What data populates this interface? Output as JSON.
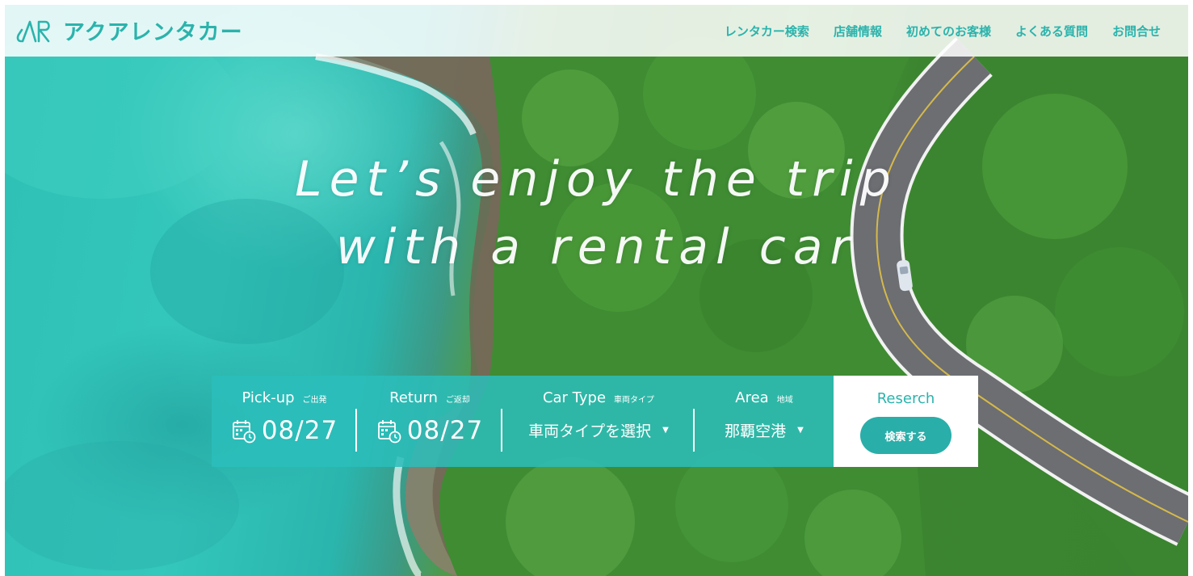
{
  "brand": {
    "name": "アクアレンタカー",
    "logo_icon": "aqua-rental-logo-icon",
    "color": "#2bb3ac"
  },
  "nav": {
    "items": [
      {
        "label": "レンタカー検索"
      },
      {
        "label": "店舗情報"
      },
      {
        "label": "初めてのお客様"
      },
      {
        "label": "よくある質問"
      },
      {
        "label": "お問合せ"
      }
    ]
  },
  "hero": {
    "tagline_line1": "Let’s enjoy the trip",
    "tagline_line2": "with a rental car"
  },
  "search": {
    "pickup": {
      "label": "Pick-up",
      "sublabel": "ご出発",
      "date": "08/27",
      "icon": "calendar-icon"
    },
    "return": {
      "label": "Return",
      "sublabel": "ご返却",
      "date": "08/27",
      "icon": "calendar-icon"
    },
    "car_type": {
      "label": "Car Type",
      "sublabel": "車両タイプ",
      "value": "車両タイプを選択"
    },
    "area": {
      "label": "Area",
      "sublabel": "地域",
      "value": "那覇空港"
    },
    "action": {
      "label": "Reserch",
      "button_label": "検索する"
    },
    "bar_color": "#2bbeba",
    "button_color": "#2aaea9"
  }
}
